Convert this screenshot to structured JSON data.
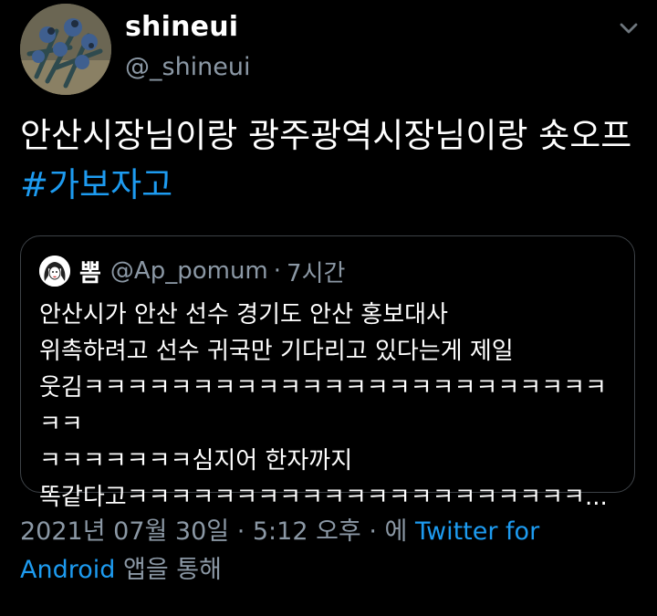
{
  "user": {
    "display_name": "shineui",
    "handle": "@_shineui"
  },
  "icons": {
    "menu": "chevron-down-icon"
  },
  "tweet": {
    "text": "안산시장님이랑 광주광역시장님이랑 숏오프 ",
    "hashtag": "#가보자고"
  },
  "quote": {
    "name": "뽐",
    "handle": "@Ap_pomum",
    "separator": "·",
    "time": "7시간",
    "text": "안산시가 안산 선수 경기도 안산 홍보대사\n위촉하려고 선수 귀국만 기다리고 있다는게 제일\n웃김ㅋㅋㅋㅋㅋㅋㅋㅋㅋㅋㅋㅋㅋㅋㅋㅋㅋㅋㅋㅋㅋㅋㅋㅋㅋㅋ\nㅋㅋㅋㅋㅋㅋㅋ심지어 한자까지\n똑같다고ㅋㅋㅋㅋㅋㅋㅋㅋㅋㅋㅋㅋㅋㅋㅋㅋㅋㅋㅋㅋㅋ..."
  },
  "meta": {
    "date": "2021년 07월 30일",
    "sep1": " · ",
    "time": "5:12 오후",
    "sep2": " · ",
    "via_prefix": "에 ",
    "client": "Twitter for Android",
    "via_suffix": " 앱을 통해"
  },
  "colors": {
    "background": "#000000",
    "accent": "#1d9bf0",
    "secondary_text": "#8b98a5",
    "border": "#3d4247"
  }
}
